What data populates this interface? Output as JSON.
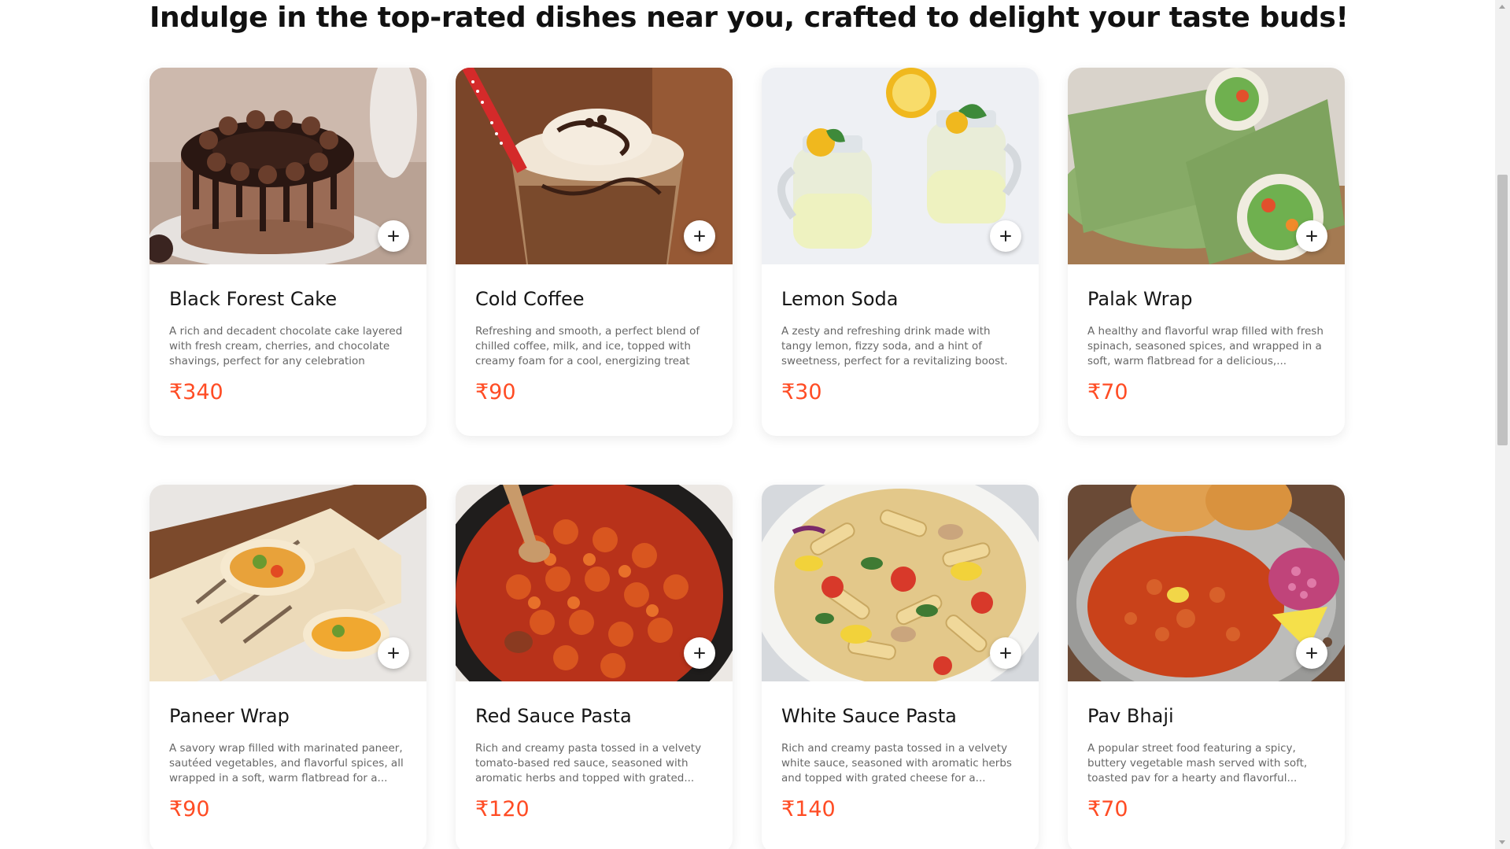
{
  "section": {
    "heading": "Indulge in the top-rated dishes near you, crafted to delight your taste buds!"
  },
  "colors": {
    "price": "#ff4c24",
    "card_bg": "#ffffff"
  },
  "dishes": [
    {
      "name": "Black Forest Cake",
      "description": "A rich and decadent chocolate cake layered with fresh cream, cherries, and chocolate shavings, perfect for any celebration",
      "price": "₹340",
      "image_icon": "chocolate-cake-image"
    },
    {
      "name": "Cold Coffee",
      "description": "Refreshing and smooth, a perfect blend of chilled coffee, milk, and ice, topped with creamy foam for a cool, energizing treat",
      "price": "₹90",
      "image_icon": "cold-coffee-image"
    },
    {
      "name": "Lemon Soda",
      "description": "A zesty and refreshing drink made with tangy lemon, fizzy soda, and a hint of sweetness, perfect for a revitalizing boost.",
      "price": "₹30",
      "image_icon": "lemon-soda-image"
    },
    {
      "name": "Palak Wrap",
      "description": "A healthy and flavorful wrap filled with fresh spinach, seasoned spices, and wrapped in a soft, warm flatbread for a delicious,...",
      "price": "₹70",
      "image_icon": "spinach-wrap-image"
    },
    {
      "name": "Paneer Wrap",
      "description": "A savory wrap filled with marinated paneer, sautéed vegetables, and flavorful spices, all wrapped in a soft, warm flatbread for a...",
      "price": "₹90",
      "image_icon": "paneer-wrap-image"
    },
    {
      "name": "Red Sauce Pasta",
      "description": "Rich and creamy pasta tossed in a velvety tomato-based red sauce, seasoned with aromatic herbs and topped with grated...",
      "price": "₹120",
      "image_icon": "red-pasta-image"
    },
    {
      "name": "White Sauce Pasta",
      "description": "Rich and creamy pasta tossed in a velvety white sauce, seasoned with aromatic herbs and topped with grated cheese for a...",
      "price": "₹140",
      "image_icon": "white-pasta-image"
    },
    {
      "name": "Pav Bhaji",
      "description": "A popular street food featuring a spicy, buttery vegetable mash served with soft, toasted pav for a hearty and flavorful...",
      "price": "₹70",
      "image_icon": "pav-bhaji-image"
    }
  ],
  "add_button_icon": "plus-icon"
}
